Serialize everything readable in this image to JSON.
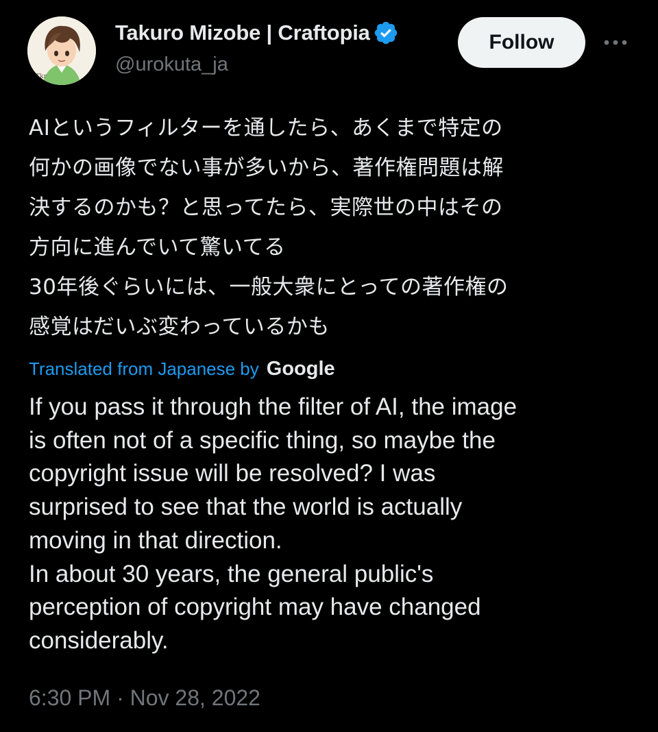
{
  "author": {
    "display_name": "Takuro Mizobe | Craftopia",
    "handle": "@urokuta_ja",
    "avatar": "avatar-illustration",
    "verified_icon": "verified-badge-icon",
    "verified_color": "#1d9bf0"
  },
  "actions": {
    "follow_label": "Follow",
    "more_icon": "more-dots-icon"
  },
  "tweet": {
    "text_ja": "AIというフィルターを通したら、あくまで特定の\n何かの画像でない事が多いから、著作権問題は解\n決するのかも？と思ってたら、実際世の中はその\n方向に進んでいて驚いてる\n30年後ぐらいには、一般大衆にとっての著作権の\n感覚はだいぶ変わっているかも",
    "translation_label": "Translated from Japanese by",
    "translation_provider": "Google",
    "text_en": "If you pass it through the filter of AI, the image\nis often not of a specific thing, so maybe the\ncopyright issue will be resolved? I was\nsurprised to see that the world is actually\nmoving in that direction.\nIn about 30 years, the general public's\nperception of copyright may have changed\nconsiderably.",
    "timestamp": "6:30 PM · Nov 28, 2022"
  },
  "colors": {
    "background": "#000000",
    "text_primary": "#e7e9ea",
    "text_secondary": "#71767b",
    "link_blue": "#1d9bf0",
    "follow_button_bg": "#eff3f4"
  }
}
